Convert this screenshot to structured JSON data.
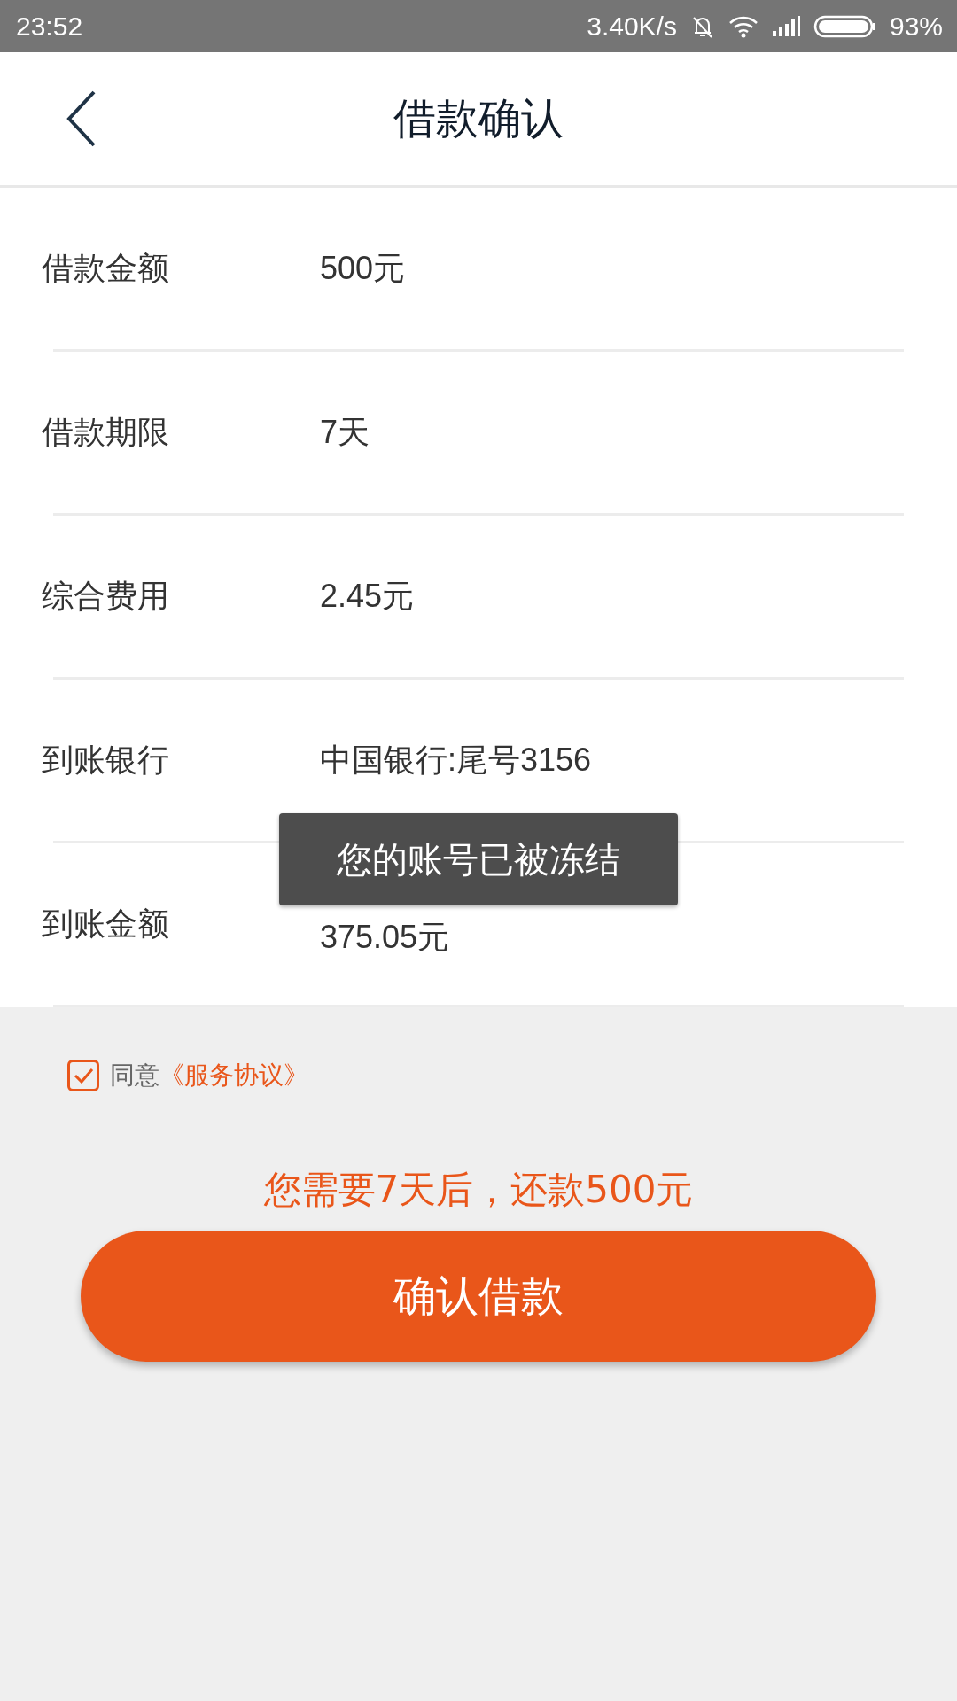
{
  "status_bar": {
    "time": "23:52",
    "speed": "3.40K/s",
    "battery": "93%"
  },
  "header": {
    "title": "借款确认"
  },
  "rows": [
    {
      "label": "借款金额",
      "value": "500元"
    },
    {
      "label": "借款期限",
      "value": "7天"
    },
    {
      "label": "综合费用",
      "value": "2.45元"
    },
    {
      "label": "到账银行",
      "value": "中国银行:尾号3156"
    },
    {
      "label": "到账金额",
      "value": "375.05元"
    }
  ],
  "toast": "您的账号已被冻结",
  "agreement": {
    "checked": true,
    "text": "同意",
    "link": "《服务协议》"
  },
  "notice": "您需要7天后，还款500元",
  "confirm_button": "确认借款"
}
